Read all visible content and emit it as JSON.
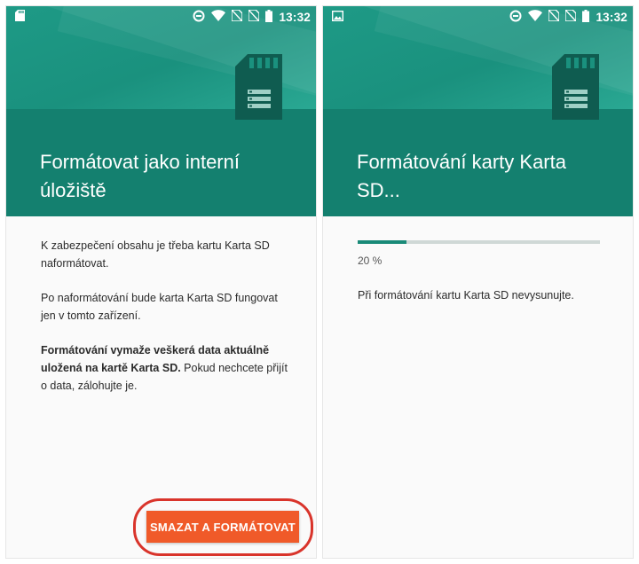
{
  "status_bar": {
    "time": "13:32"
  },
  "screen_left": {
    "title": "Formátovat jako interní úložiště",
    "paragraph1": "K zabezpečení obsahu je třeba kartu Karta SD naformátovat.",
    "paragraph2": "Po naformátování bude karta Karta SD fungovat jen v tomto zařízení.",
    "paragraph3_bold": "Formátování vymaže veškerá data aktuálně uložená na kartě Karta SD.",
    "paragraph3_rest": " Pokud nechcete přijít o data, zálohujte je.",
    "action_button": "SMAZAT A FORMÁTOVAT"
  },
  "screen_right": {
    "title": "Formátování karty Karta SD...",
    "progress_value": 0.2,
    "progress_label": "20 %",
    "message": "Při formátování kartu Karta SD nevysunujte."
  },
  "colors": {
    "header_teal": "#14806f",
    "accent_orange": "#f05a29",
    "highlight_red": "#d9342b",
    "progress_teal": "#1a8a78"
  },
  "icons": [
    "sd-card-notification-icon",
    "image-notification-icon",
    "data-saver-icon",
    "wifi-icon",
    "no-sim-icon",
    "battery-icon",
    "sd-card-icon"
  ]
}
